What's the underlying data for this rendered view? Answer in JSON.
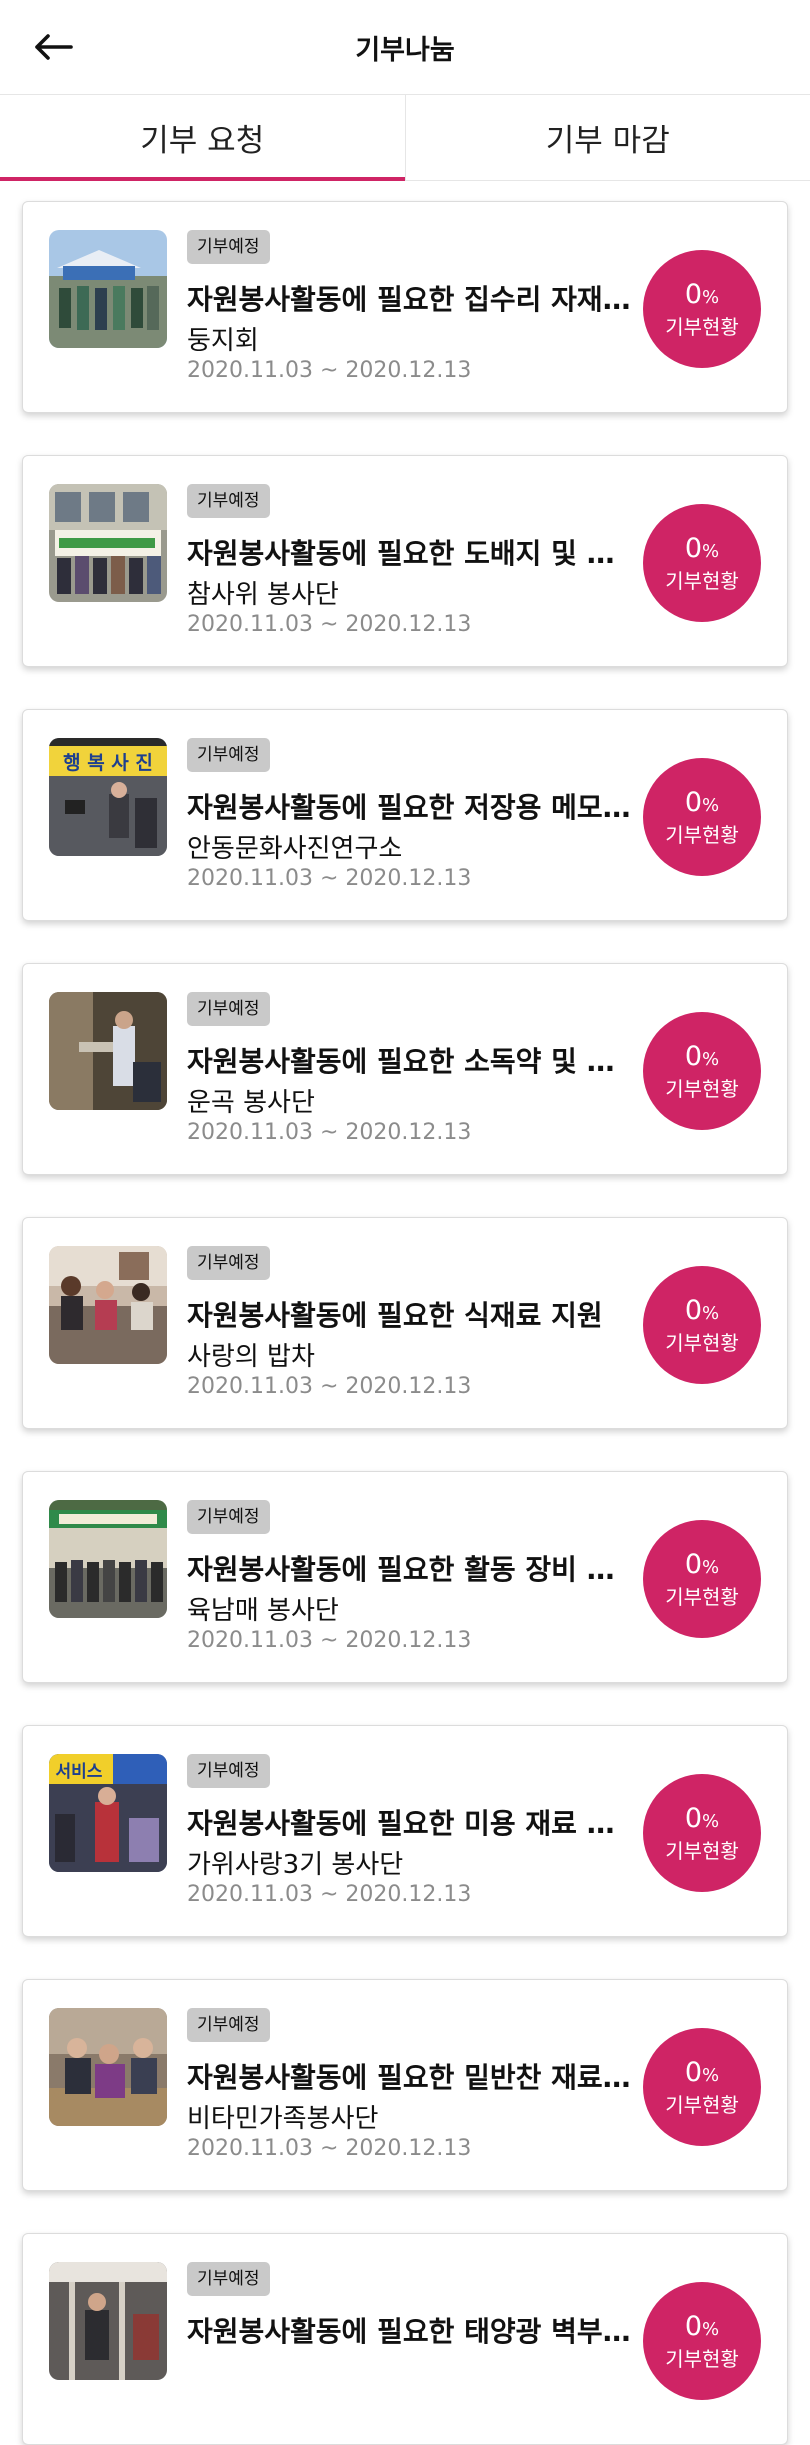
{
  "appbar": {
    "title": "기부나눔",
    "back_icon": "arrow-left-icon"
  },
  "tabs": [
    {
      "label": "기부 요청",
      "active": true
    },
    {
      "label": "기부 마감",
      "active": false
    }
  ],
  "accent_color": "#cf2465",
  "items": [
    {
      "badge": "기부예정",
      "title": "자원봉사활동에 필요한 집수리 자재 ...",
      "org": "둥지회",
      "date": "2020.11.03 ~ 2020.12.13",
      "percent": "0",
      "percent_unit": "%",
      "status_label": "기부현황"
    },
    {
      "badge": "기부예정",
      "title": "자원봉사활동에 필요한 도배지 및 장...",
      "org": "참사위 봉사단",
      "date": "2020.11.03 ~ 2020.12.13",
      "percent": "0",
      "percent_unit": "%",
      "status_label": "기부현황"
    },
    {
      "badge": "기부예정",
      "title": "자원봉사활동에 필요한 저장용 메모...",
      "org": "안동문화사진연구소",
      "date": "2020.11.03 ~ 2020.12.13",
      "percent": "0",
      "percent_unit": "%",
      "status_label": "기부현황"
    },
    {
      "badge": "기부예정",
      "title": "자원봉사활동에 필요한 소독약 및 분...",
      "org": "운곡 봉사단",
      "date": "2020.11.03 ~ 2020.12.13",
      "percent": "0",
      "percent_unit": "%",
      "status_label": "기부현황"
    },
    {
      "badge": "기부예정",
      "title": "자원봉사활동에 필요한 식재료 지원",
      "org": "사랑의 밥차",
      "date": "2020.11.03 ~ 2020.12.13",
      "percent": "0",
      "percent_unit": "%",
      "status_label": "기부현황"
    },
    {
      "badge": "기부예정",
      "title": "자원봉사활동에 필요한 활동 장비 및 ...",
      "org": "육남매 봉사단",
      "date": "2020.11.03 ~ 2020.12.13",
      "percent": "0",
      "percent_unit": "%",
      "status_label": "기부현황"
    },
    {
      "badge": "기부예정",
      "title": "자원봉사활동에 필요한 미용 재료 지원",
      "org": "가위사랑3기 봉사단",
      "date": "2020.11.03 ~ 2020.12.13",
      "percent": "0",
      "percent_unit": "%",
      "status_label": "기부현황"
    },
    {
      "badge": "기부예정",
      "title": "자원봉사활동에 필요한 밑반찬 재료 ...",
      "org": "비타민가족봉사단",
      "date": "2020.11.03 ~ 2020.12.13",
      "percent": "0",
      "percent_unit": "%",
      "status_label": "기부현황"
    },
    {
      "badge": "기부예정",
      "title": "자원봉사활동에 필요한 태양광 벽부...",
      "org": "",
      "date": "",
      "percent": "0",
      "percent_unit": "%",
      "status_label": "기부현황"
    }
  ],
  "thumb_text": {
    "2": "행 복 사 진",
    "6": "서비스"
  }
}
